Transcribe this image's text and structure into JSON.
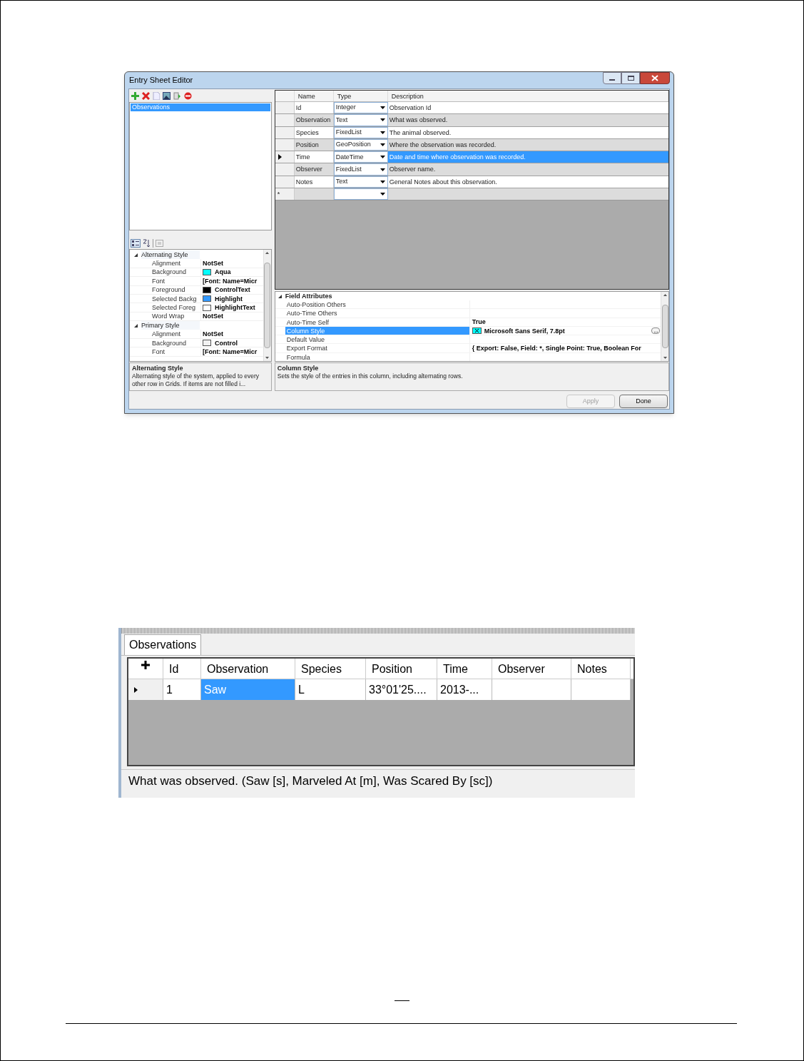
{
  "editor": {
    "title": "Entry Sheet Editor",
    "sheets": [
      {
        "label": "Observations",
        "selected": true
      }
    ],
    "style_properties": {
      "groups": [
        {
          "name": "Alternating Style",
          "expanded": true,
          "rows": [
            {
              "name": "Alignment",
              "value": "NotSet"
            },
            {
              "name": "Background",
              "value": "Aqua",
              "color": "#00ffff"
            },
            {
              "name": "Font",
              "value": "[Font: Name=Micr"
            },
            {
              "name": "Foreground",
              "value": "ControlText",
              "color": "#000000"
            },
            {
              "name": "Selected Backg",
              "value": "Highlight",
              "color": "#3399ff"
            },
            {
              "name": "Selected Foreg",
              "value": "HighlightText",
              "color": "#ffffff"
            },
            {
              "name": "Word Wrap",
              "value": "NotSet"
            }
          ]
        },
        {
          "name": "Primary Style",
          "expanded": true,
          "rows": [
            {
              "name": "Alignment",
              "value": "NotSet"
            },
            {
              "name": "Background",
              "value": "Control",
              "color": "#f0f0f0"
            },
            {
              "name": "Font",
              "value": "[Font: Name=Micr"
            }
          ]
        }
      ]
    },
    "style_description": {
      "title": "Alternating Style",
      "text": "Alternating style of the system, applied to every other row in Grids. If items are not filled i..."
    },
    "fields": {
      "columns": [
        "Name",
        "Type",
        "Description"
      ],
      "rows": [
        {
          "name": "Id",
          "type": "Integer",
          "description": "Observation Id",
          "current": false,
          "selected": false
        },
        {
          "name": "Observation",
          "type": "Text",
          "description": "What was observed.",
          "current": false,
          "selected": false
        },
        {
          "name": "Species",
          "type": "FixedList",
          "description": "The animal observed.",
          "current": false,
          "selected": false
        },
        {
          "name": "Position",
          "type": "GeoPosition",
          "description": "Where the observation was recorded.",
          "current": false,
          "selected": false
        },
        {
          "name": "Time",
          "type": "DateTime",
          "description": "Date and time where observation was recorded.",
          "current": true,
          "selected": true
        },
        {
          "name": "Observer",
          "type": "FixedList",
          "description": "Observer name.",
          "current": false,
          "selected": false
        },
        {
          "name": "Notes",
          "type": "Text",
          "description": "General Notes about this observation.",
          "current": false,
          "selected": false
        }
      ],
      "new_row_marker": "*"
    },
    "field_attributes": {
      "category": "Field Attributes",
      "expanded": true,
      "rows": [
        {
          "name": "Auto-Position Others",
          "selected": false
        },
        {
          "name": "Auto-Time Others",
          "selected": false
        },
        {
          "name": "Auto-Time Self",
          "value": "True",
          "selected": false
        },
        {
          "name": "Column Style",
          "value": "Microsoft Sans Serif, 7.8pt",
          "selected": true,
          "kind": "style"
        },
        {
          "name": "Default Value",
          "selected": false
        },
        {
          "name": "Export Format",
          "value": "{ Export: False, Field: *, Single Point: True, Boolean For",
          "selected": false
        },
        {
          "name": "Formula",
          "selected": false
        }
      ]
    },
    "field_description": {
      "title": "Column Style",
      "text": "Sets the style of the entries in this column, including alternating rows."
    },
    "buttons": [
      {
        "label": "Apply",
        "disabled": true
      },
      {
        "label": "Done",
        "disabled": false
      }
    ]
  },
  "entry_sheet": {
    "tabs": [
      {
        "label": "Observations",
        "selected": true
      }
    ],
    "columns": [
      "Id",
      "Observation",
      "Species",
      "Position",
      "Time",
      "Observer",
      "Notes"
    ],
    "rows": [
      {
        "current": true,
        "cells": [
          {
            "text": "1",
            "selected": false
          },
          {
            "text": "Saw",
            "selected": true
          },
          {
            "text": "L",
            "selected": false
          },
          {
            "text": "33°01'25....",
            "selected": false
          },
          {
            "text": "2013-...",
            "selected": false
          }
        ]
      }
    ],
    "status": "What was observed. (Saw [s], Marveled At [m], Was Scared By [sc])"
  }
}
